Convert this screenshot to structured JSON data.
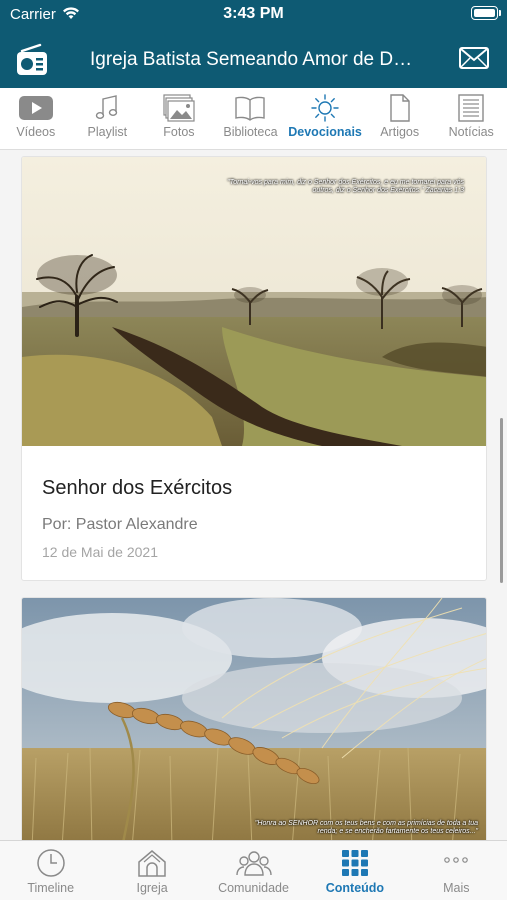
{
  "status_bar": {
    "carrier": "Carrier",
    "time": "3:43 PM"
  },
  "header": {
    "title": "Igreja Batista Semeando Amor de Deus",
    "left_icon": "radio-icon",
    "right_icon": "mail-icon"
  },
  "content_tabs": [
    {
      "label": "Vídeos",
      "icon": "video-icon"
    },
    {
      "label": "Playlist",
      "icon": "music-note-icon"
    },
    {
      "label": "Fotos",
      "icon": "photos-icon"
    },
    {
      "label": "Biblioteca",
      "icon": "book-icon"
    },
    {
      "label": "Devocionais",
      "icon": "sun-icon",
      "active": true
    },
    {
      "label": "Artigos",
      "icon": "document-icon"
    },
    {
      "label": "Notícias",
      "icon": "newspaper-icon"
    }
  ],
  "posts": [
    {
      "image_caption": "\"Tornai-vos para mim, diz o Senhor dos Exércitos, e eu me tornarei para vós outros, diz o Senhor dos Exércitos.\" Zacarias 1:3",
      "title": "Senhor dos Exércitos",
      "author": "Por: Pastor Alexandre",
      "date": "12 de Mai de 2021"
    },
    {
      "image_caption": "\"Honra ao SENHOR com os teus bens e com as primícias de toda a tua renda; e se encherão fartamente os teus celeiros...\"",
      "title": "",
      "author": "",
      "date": ""
    }
  ],
  "tab_bar": [
    {
      "label": "Timeline",
      "icon": "clock-icon"
    },
    {
      "label": "Igreja",
      "icon": "church-icon"
    },
    {
      "label": "Comunidade",
      "icon": "community-icon"
    },
    {
      "label": "Conteúdo",
      "icon": "grid-icon",
      "active": true
    },
    {
      "label": "Mais",
      "icon": "more-icon"
    }
  ],
  "colors": {
    "header_bg": "#0e5a73",
    "accent": "#1e78b4",
    "inactive": "#8a8a8a"
  }
}
